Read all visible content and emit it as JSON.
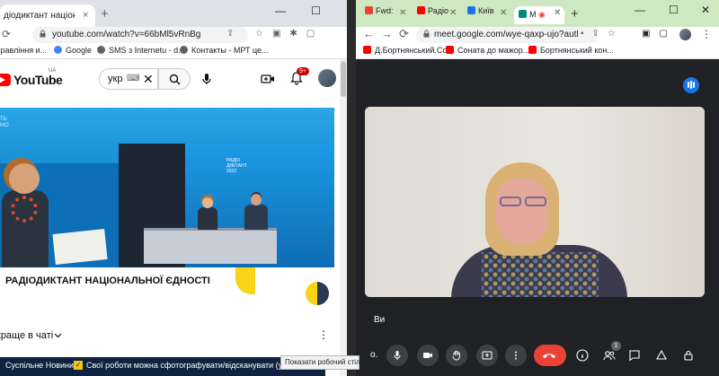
{
  "left_window": {
    "tab": {
      "title": "діодиктант національн",
      "close": "×"
    },
    "new_tab": "+",
    "window_controls": {
      "minimize": "—",
      "maximize": "☐"
    },
    "url": "youtube.com/watch?v=66bMl5vRnBg",
    "bookmarks": [
      {
        "label": "хравління и..."
      },
      {
        "label": "Google"
      },
      {
        "label": "SMS з Internetu - d..."
      },
      {
        "label": "Контакты - МРТ це..."
      }
    ],
    "youtube": {
      "logo_text": "YouTube",
      "region": "UA",
      "search_value": "укр",
      "search_keyboard": "⌨",
      "notification_count": "9+",
      "video": {
        "corner_text": "ТЬ\nМО",
        "screen_text": "РАДІО\nДИКТАНТ\n2022",
        "banner_title": "РАДІОДИКТАНТ НАЦІОНАЛЬНОЇ ЄДНОСТІ"
      },
      "chat_label": "краще в чаті",
      "chat_more": "⋮",
      "ticker": {
        "source": "Суспільне Новини",
        "chip": "✓",
        "headline": "Свої роботи можна сфотографувати/відсканувати (у форматі..."
      }
    }
  },
  "right_window": {
    "tabs": [
      {
        "label": "Fwd:",
        "favicon": "gmail",
        "color": "#ea4335"
      },
      {
        "label": "Радіо",
        "favicon": "youtube",
        "color": "#ff0000"
      },
      {
        "label": "Київ",
        "favicon": "docs",
        "color": "#1a73e8"
      },
      {
        "label": "М",
        "favicon": "meet",
        "color": "#00897b",
        "active": true
      }
    ],
    "new_tab": "+",
    "window_controls": {
      "minimize": "—",
      "maximize": "☐",
      "close": "✕"
    },
    "url": "meet.google.com/wye-qaxp-ujo?authu...",
    "bookmarks": [
      {
        "label": "Д.Бортнянський.Со..."
      },
      {
        "label": "Соната до мажор..."
      },
      {
        "label": "Бортнянський кон..."
      }
    ],
    "meet": {
      "self_name": "Ви",
      "participants_count": "1",
      "tooltip": "Показати робочий стіл"
    }
  },
  "colors": {
    "chrome_tab_left": "#dee1e6",
    "chrome_tab_right": "#cfe8c4",
    "meet_bg": "#202124",
    "hangup": "#ea4335",
    "youtube_red": "#ff0000",
    "ticker_bg": "#0f2240",
    "banner_accent": "#f7d417"
  }
}
